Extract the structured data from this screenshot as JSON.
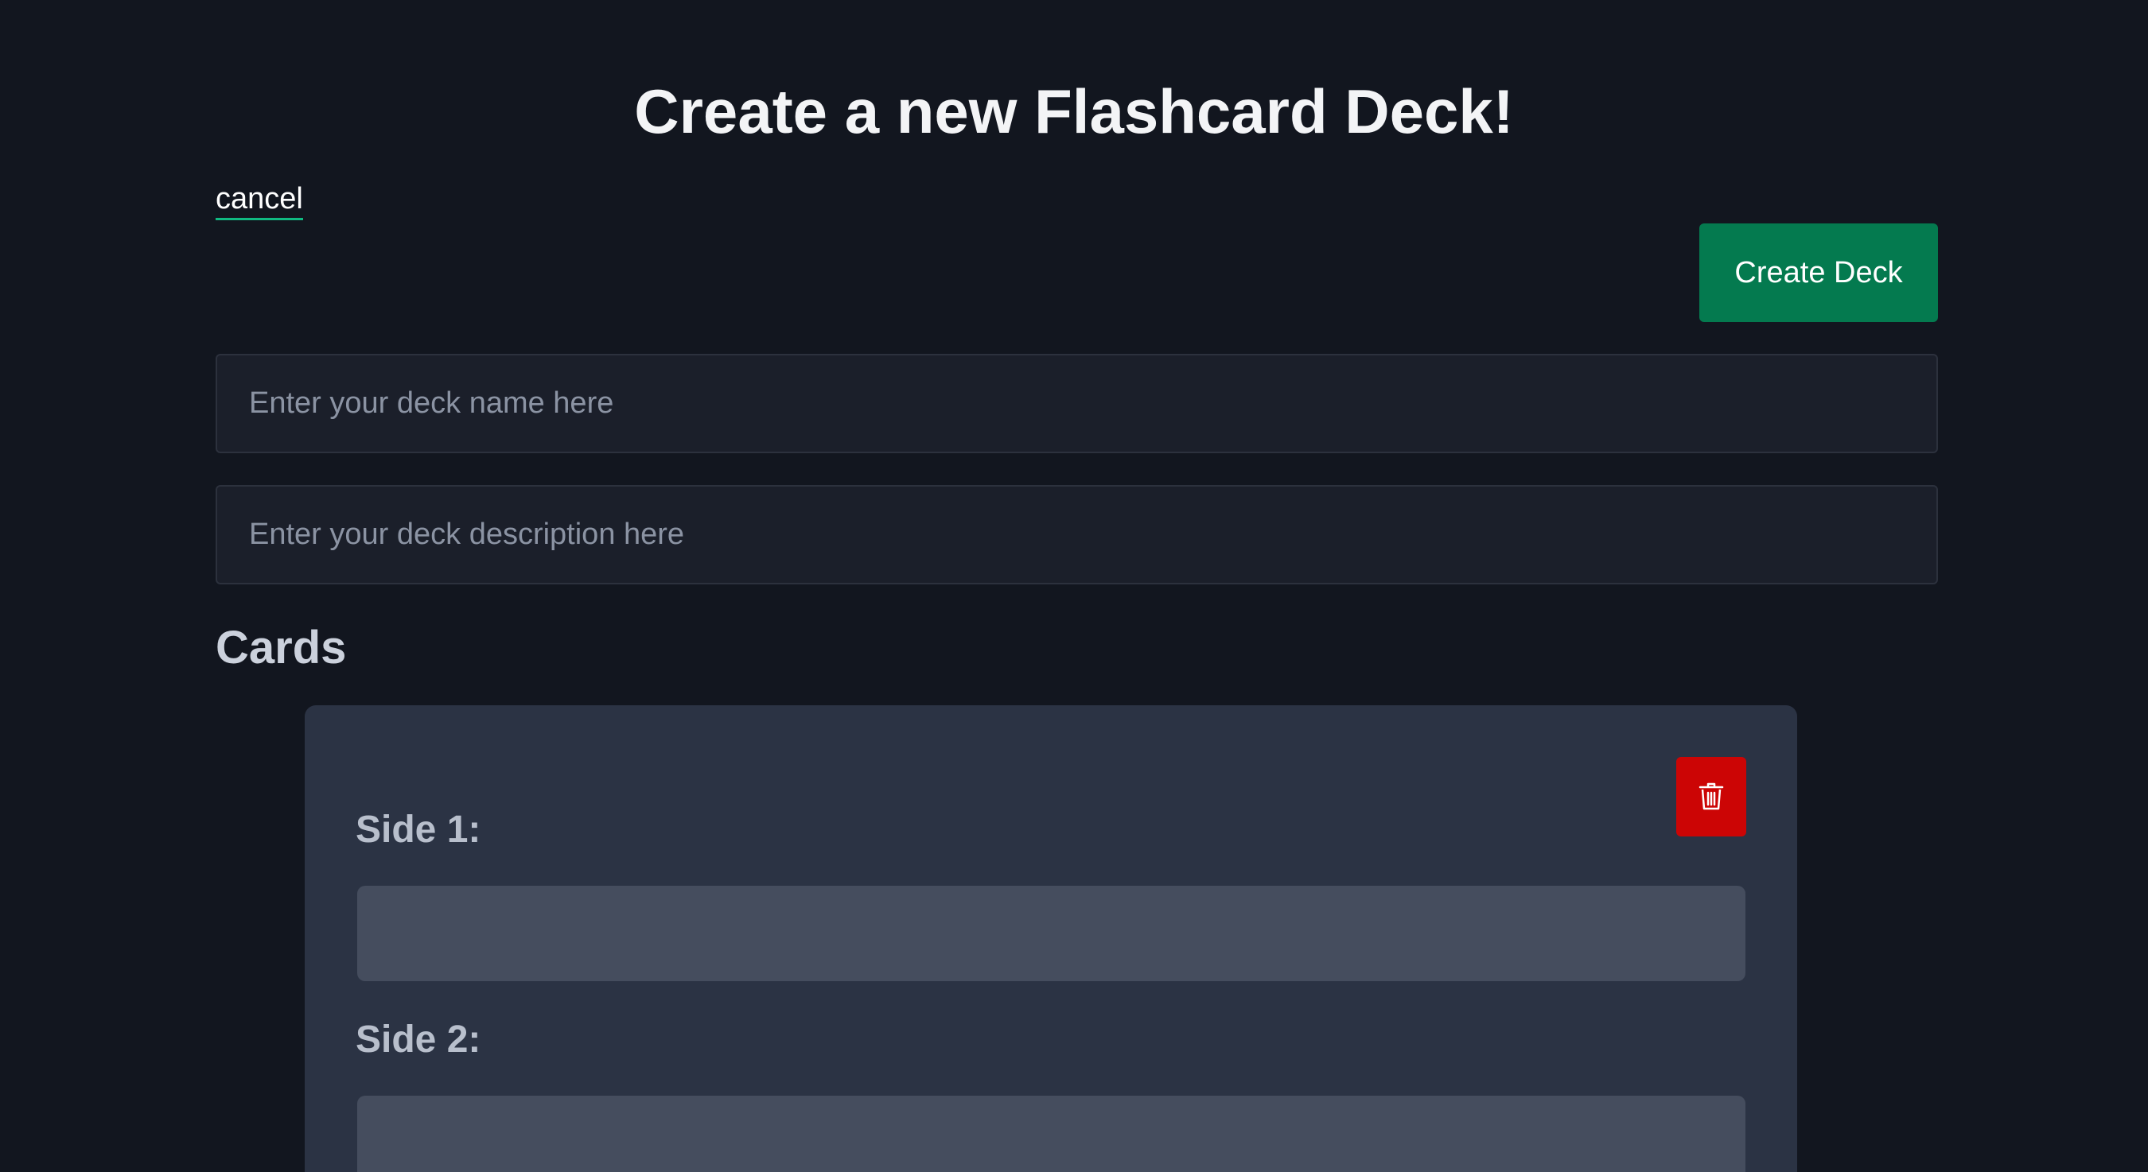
{
  "page": {
    "title": "Create a new Flashcard Deck!"
  },
  "actions": {
    "cancel_label": "cancel",
    "create_label": "Create Deck"
  },
  "deck_form": {
    "name_placeholder": "Enter your deck name here",
    "name_value": "",
    "description_placeholder": "Enter your deck description here",
    "description_value": ""
  },
  "cards_section": {
    "title": "Cards",
    "cards": [
      {
        "side1_label": "Side 1:",
        "side1_value": "",
        "side2_label": "Side 2:",
        "side2_value": "",
        "delete_icon": "trash-icon"
      }
    ]
  },
  "colors": {
    "background": "#12161f",
    "accent_green": "#047a4f",
    "danger_red": "#cc0505",
    "card_background": "#2b3344",
    "input_background": "#1b1f2a"
  }
}
